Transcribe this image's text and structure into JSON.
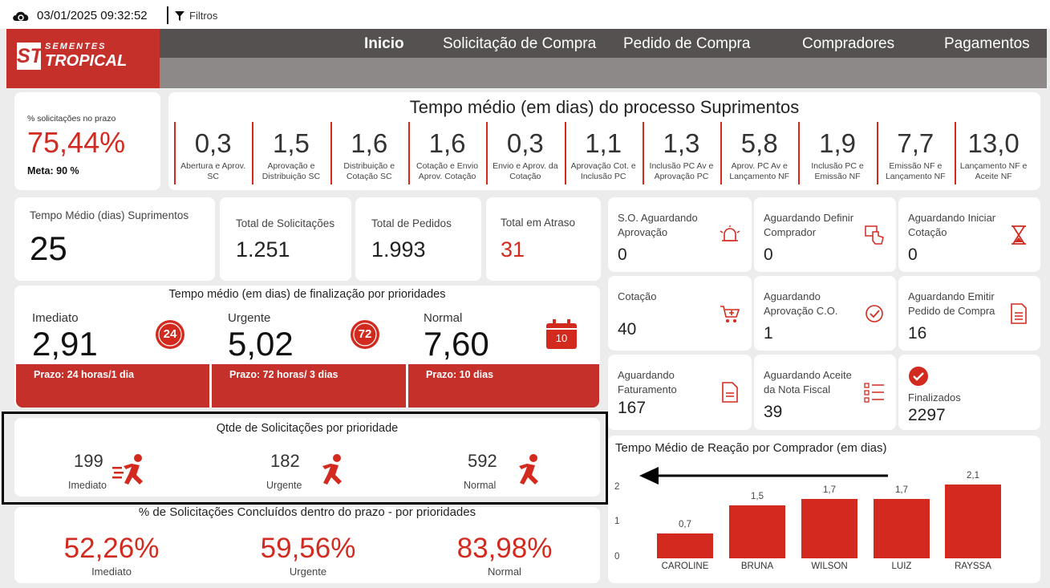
{
  "topbar": {
    "timestamp": "03/01/2025 09:32:52",
    "filters_label": "Filtros"
  },
  "brand": {
    "initials": "ST",
    "line1": "SEMENTES",
    "line2": "TROPICAL"
  },
  "nav": {
    "items": [
      "Inicio",
      "Solicitação de Compra",
      "Pedido de Compra",
      "Compradores",
      "Pagamentos"
    ]
  },
  "deadline_kpi": {
    "label": "% solicitações no prazo",
    "value": "75,44%",
    "target": "Meta: 90 %"
  },
  "process": {
    "title": "Tempo médio (em dias) do processo Suprimentos",
    "stages": [
      {
        "value": "0,3",
        "label": "Abertura e Aprov. SC"
      },
      {
        "value": "1,5",
        "label": "Aprovação e Distribuição SC"
      },
      {
        "value": "1,6",
        "label": "Distribuição e Cotação SC"
      },
      {
        "value": "1,6",
        "label": "Cotação e Envio Aprov. Cotação"
      },
      {
        "value": "0,3",
        "label": "Envio e Aprov. da Cotação"
      },
      {
        "value": "1,1",
        "label": "Aprovação Cot. e Inclusão PC"
      },
      {
        "value": "1,3",
        "label": "Inclusão PC Av e Aprovação PC"
      },
      {
        "value": "5,8",
        "label": "Aprov. PC Av e Lançamento NF"
      },
      {
        "value": "1,9",
        "label": "Inclusão PC e Emissão NF"
      },
      {
        "value": "7,7",
        "label": "Emissão NF e Lançamento NF"
      },
      {
        "value": "13,0",
        "label": "Lançamento NF e Aceite NF"
      }
    ]
  },
  "summary": {
    "avg_time": {
      "label": "Tempo Médio (dias) Suprimentos",
      "value": "25"
    },
    "total_requests": {
      "label": "Total de Solicitações",
      "value": "1.251"
    },
    "total_orders": {
      "label": "Total de Pedidos",
      "value": "1.993"
    },
    "total_late": {
      "label": "Total em Atraso",
      "value": "31"
    }
  },
  "priority_time": {
    "title": "Tempo médio (em dias) de finalização por prioridades",
    "items": [
      {
        "label": "Imediato",
        "value": "2,91",
        "badge": "24",
        "deadline": "Prazo: 24 horas/1 dia"
      },
      {
        "label": "Urgente",
        "value": "5,02",
        "badge": "72",
        "deadline": "Prazo: 72 horas/ 3 dias"
      },
      {
        "label": "Normal",
        "value": "7,60",
        "badge": "10",
        "deadline": "Prazo: 10 dias"
      }
    ]
  },
  "priority_count": {
    "title": "Qtde de Solicitações por prioridade",
    "items": [
      {
        "value": "199",
        "label": "Imediato"
      },
      {
        "value": "182",
        "label": "Urgente"
      },
      {
        "value": "592",
        "label": "Normal"
      }
    ]
  },
  "priority_pct": {
    "title": "% de Solicitações Concluídos dentro do prazo - por prioridades",
    "items": [
      {
        "value": "52,26%",
        "label": "Imediato"
      },
      {
        "value": "59,56%",
        "label": "Urgente"
      },
      {
        "value": "83,98%",
        "label": "Normal"
      }
    ]
  },
  "status_cards": [
    {
      "label": "S.O. Aguardando Aprovação",
      "value": "0",
      "icon": "alarm-bell-icon"
    },
    {
      "label": "Aguardando Definir Comprador",
      "value": "0",
      "icon": "hand-pointer-icon"
    },
    {
      "label": "Aguardando Iniciar Cotação",
      "value": "0",
      "icon": "hourglass-icon"
    },
    {
      "label": "Cotação",
      "value": "40",
      "icon": "cart-add-icon"
    },
    {
      "label": "Aguardando Aprovação C.O.",
      "value": "1",
      "icon": "check-badge-icon"
    },
    {
      "label": "Aguardando Emitir Pedido de Compra",
      "value": "16",
      "icon": "document-icon"
    },
    {
      "label": "Aguardando Faturamento",
      "value": "167",
      "icon": "invoice-icon"
    },
    {
      "label": "Aguardando Aceite da Nota Fiscal",
      "value": "39",
      "icon": "checklist-icon"
    },
    {
      "label": "Finalizados",
      "value": "2297",
      "icon": "check-circle-icon"
    }
  ],
  "colors": {
    "accent": "#d32a1f",
    "brand": "#c6302b",
    "nav_dark": "#555150",
    "nav_gray": "#8c8988"
  },
  "chart_data": {
    "type": "bar",
    "title": "Tempo Médio de Reação por Comprador (em dias)",
    "categories": [
      "CAROLINE",
      "BRUNA",
      "WILSON",
      "LUIZ",
      "RAYSSA"
    ],
    "values": [
      0.7,
      1.5,
      1.7,
      1.7,
      2.1
    ],
    "value_labels": [
      "0,7",
      "1,5",
      "1,7",
      "1,7",
      "2,1"
    ],
    "yticks": [
      "0",
      "1",
      "2"
    ],
    "ylim": [
      0,
      2.4
    ],
    "grid": false,
    "legend": "none"
  }
}
